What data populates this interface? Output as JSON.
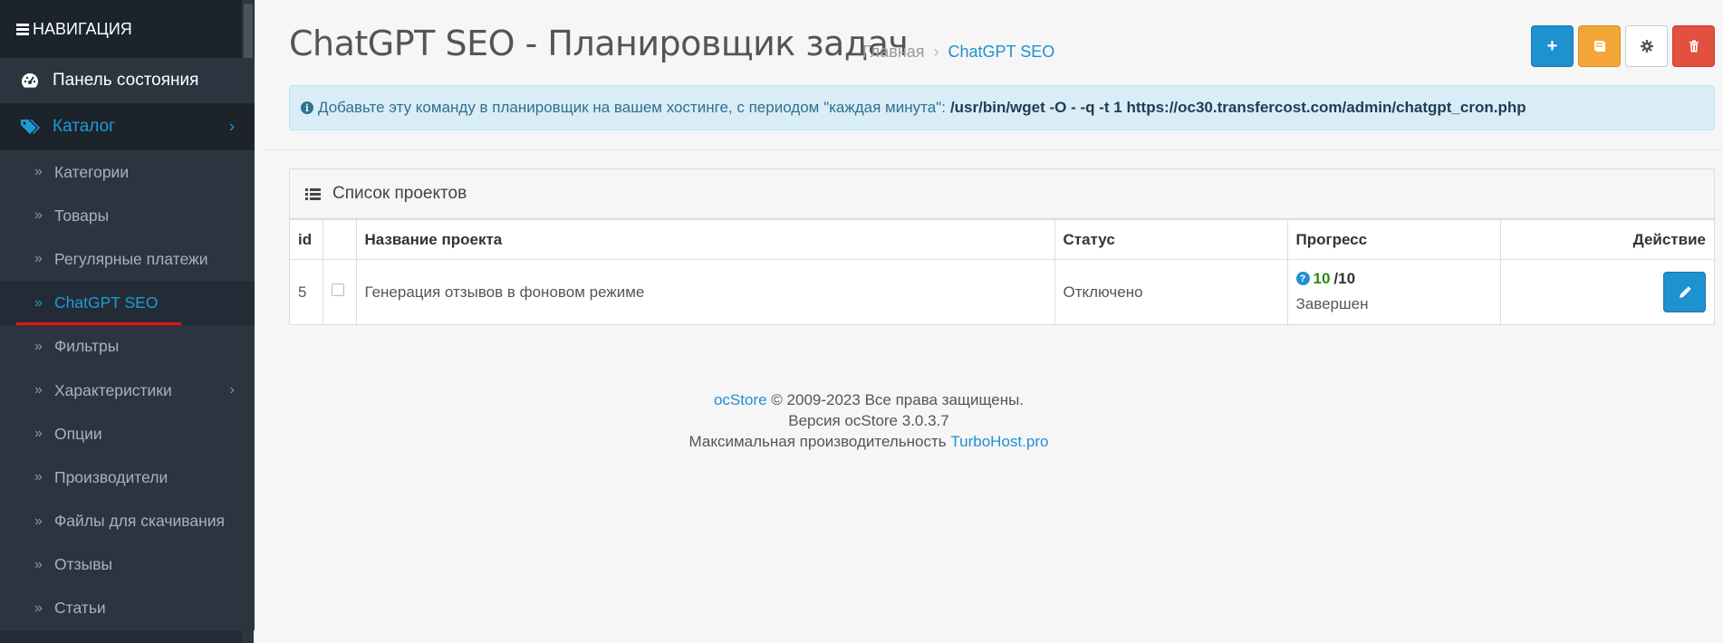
{
  "sidebar": {
    "header": "НАВИГАЦИЯ",
    "items": [
      {
        "label": "Панель состояния"
      },
      {
        "label": "Каталог"
      }
    ],
    "sub_items": [
      {
        "label": "Категории"
      },
      {
        "label": "Товары"
      },
      {
        "label": "Регулярные платежи"
      },
      {
        "label": "ChatGPT SEO"
      },
      {
        "label": "Фильтры"
      },
      {
        "label": "Характеристики"
      },
      {
        "label": "Опции"
      },
      {
        "label": "Производители"
      },
      {
        "label": "Файлы для скачивания"
      },
      {
        "label": "Отзывы"
      },
      {
        "label": "Статьи"
      }
    ]
  },
  "header": {
    "title": "ChatGPT SEO - Планировщик задач",
    "breadcrumb": [
      "Главная",
      "ChatGPT SEO"
    ]
  },
  "toolbar": {
    "buttons": [
      "plus-icon",
      "book-icon",
      "gear-icon",
      "trash-icon"
    ]
  },
  "alert": {
    "text": "Добавьте эту команду в планировщик на вашем хостинге, с периодом \"каждая минута\":",
    "command": "/usr/bin/wget -O - -q -t 1 https://oc30.transfercost.com/admin/chatgpt_cron.php"
  },
  "panel": {
    "title": "Список проектов",
    "columns": {
      "id": "id",
      "name": "Название проекта",
      "status": "Статус",
      "progress": "Прогресс",
      "action": "Действие"
    },
    "rows": [
      {
        "id": "5",
        "name": "Генерация отзывов в фоновом режиме",
        "status": "Отключено",
        "progress_done": "10",
        "progress_total": "/10",
        "progress_state": "Завершен"
      }
    ]
  },
  "footer": {
    "brand": "ocStore",
    "copyright": "© 2009-2023 Все права защищены.",
    "version": "Версия ocStore 3.0.3.7",
    "perf_text": "Максимальная производительность",
    "perf_link": "TurboHost.pro"
  },
  "colors": {
    "accent": "#1e91cf",
    "sidebar_bg": "#232c36",
    "success": "#2b8a0f",
    "warning": "#f3a638",
    "danger": "#e3503e"
  }
}
